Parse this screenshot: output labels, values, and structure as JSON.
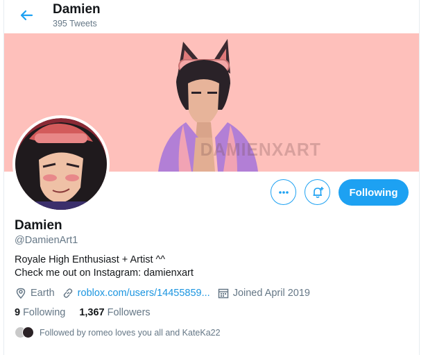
{
  "header": {
    "title": "Damien",
    "tweet_count": "395 Tweets"
  },
  "banner": {
    "watermark": "DAMIENXART",
    "background_color": "#fec0bb"
  },
  "profile": {
    "name": "Damien",
    "handle": "@DamienArt1",
    "bio_line1": "Royale High Enthusiast + Artist ^^",
    "bio_line2": "Check me out on Instagram: damienxart",
    "location": "Earth",
    "website": "roblox.com/users/14455859...",
    "joined": "Joined April 2019",
    "following_count": "9",
    "following_label": "Following",
    "followers_count": "1,367",
    "followers_label": "Followers",
    "followed_by": "Followed by romeo loves you all and KateKa22"
  },
  "actions": {
    "follow_label": "Following",
    "accent_color": "#1da1f2"
  },
  "icons": [
    "back-arrow-icon",
    "more-icon",
    "notification-bell-icon",
    "location-pin-icon",
    "link-icon",
    "calendar-icon"
  ]
}
